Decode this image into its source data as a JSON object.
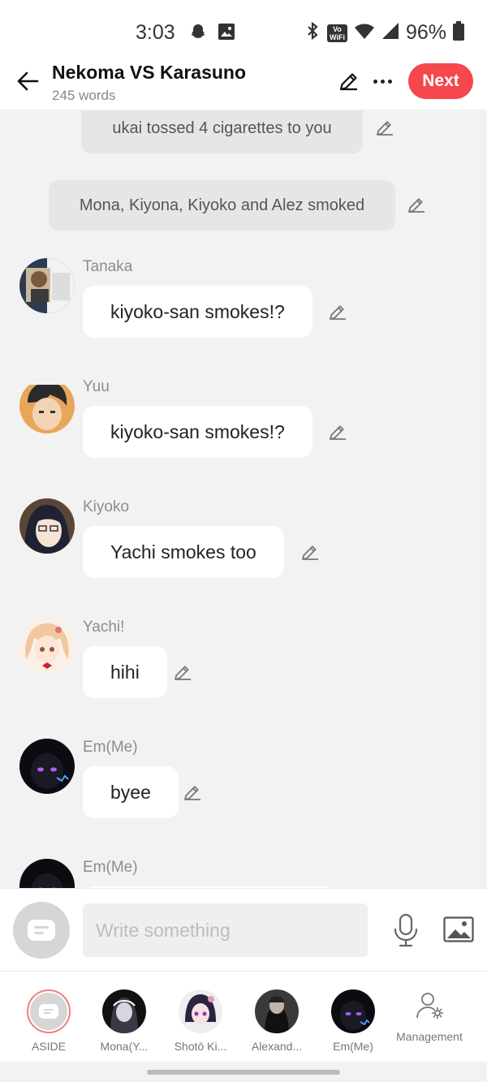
{
  "status_bar": {
    "time": "3:03",
    "battery": "96%",
    "vowifi": "Vo\nWiFi",
    "icons": [
      "snapchat-icon",
      "gallery-icon",
      "bluetooth-icon",
      "vowifi-icon",
      "wifi-icon",
      "signal-icon",
      "battery-icon"
    ]
  },
  "header": {
    "title": "Nekoma VS Karasuno",
    "subtitle": "245 words",
    "next_label": "Next",
    "accent": "#f5474c"
  },
  "narrations": [
    {
      "text": "ukai tossed 4 cigarettes to you"
    },
    {
      "text": "Mona, Kiyona, Kiyoko and Alez smoked"
    }
  ],
  "messages": [
    {
      "sender": "Tanaka",
      "text": "kiyoko-san smokes!?"
    },
    {
      "sender": "Yuu",
      "text": "kiyoko-san smokes!?"
    },
    {
      "sender": "Kiyoko",
      "text": "Yachi smokes too"
    },
    {
      "sender": "Yachi!",
      "text": "hihi"
    },
    {
      "sender": "Em(Me)",
      "text": "byee"
    },
    {
      "sender": "Em(Me)",
      "text": ""
    }
  ],
  "composer": {
    "placeholder": "Write something"
  },
  "characters": [
    {
      "name": "ASIDE"
    },
    {
      "name": "Mona(Y..."
    },
    {
      "name": "Shotō Ki..."
    },
    {
      "name": "Alexand..."
    },
    {
      "name": "Em(Me)"
    },
    {
      "name": "Management"
    }
  ]
}
